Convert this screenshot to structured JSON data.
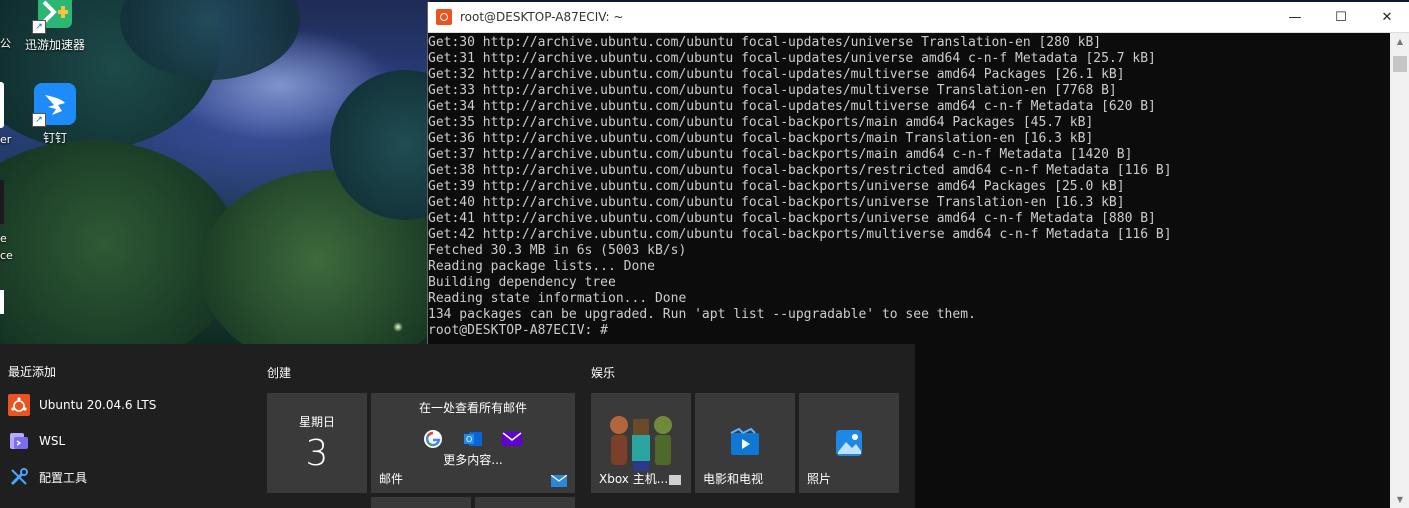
{
  "desktop": {
    "icons": [
      {
        "label": "迅游加速器",
        "icon": "xunyou-accelerator-icon"
      },
      {
        "label": "钉钉",
        "icon": "dingtalk-icon"
      }
    ],
    "edge_labels": [
      "公",
      "er",
      "e",
      "ce"
    ]
  },
  "terminal": {
    "title": "root@DESKTOP-A87ECIV: ~",
    "buttons": {
      "minimize": "—",
      "maximize": "☐",
      "close": "✕"
    },
    "lines": [
      "Get:30 http://archive.ubuntu.com/ubuntu focal-updates/universe Translation-en [280 kB]",
      "Get:31 http://archive.ubuntu.com/ubuntu focal-updates/universe amd64 c-n-f Metadata [25.7 kB]",
      "Get:32 http://archive.ubuntu.com/ubuntu focal-updates/multiverse amd64 Packages [26.1 kB]",
      "Get:33 http://archive.ubuntu.com/ubuntu focal-updates/multiverse Translation-en [7768 B]",
      "Get:34 http://archive.ubuntu.com/ubuntu focal-updates/multiverse amd64 c-n-f Metadata [620 B]",
      "Get:35 http://archive.ubuntu.com/ubuntu focal-backports/main amd64 Packages [45.7 kB]",
      "Get:36 http://archive.ubuntu.com/ubuntu focal-backports/main Translation-en [16.3 kB]",
      "Get:37 http://archive.ubuntu.com/ubuntu focal-backports/main amd64 c-n-f Metadata [1420 B]",
      "Get:38 http://archive.ubuntu.com/ubuntu focal-backports/restricted amd64 c-n-f Metadata [116 B]",
      "Get:39 http://archive.ubuntu.com/ubuntu focal-backports/universe amd64 Packages [25.0 kB]",
      "Get:40 http://archive.ubuntu.com/ubuntu focal-backports/universe Translation-en [16.3 kB]",
      "Get:41 http://archive.ubuntu.com/ubuntu focal-backports/universe amd64 c-n-f Metadata [880 B]",
      "Get:42 http://archive.ubuntu.com/ubuntu focal-backports/multiverse amd64 c-n-f Metadata [116 B]",
      "Fetched 30.3 MB in 6s (5003 kB/s)",
      "Reading package lists... Done",
      "Building dependency tree",
      "Reading state information... Done",
      "134 packages can be upgraded. Run 'apt list --upgradable' to see them.",
      "root@DESKTOP-A87ECIV: #"
    ]
  },
  "startmenu": {
    "recent_title": "最近添加",
    "recent_items": [
      {
        "label": "Ubuntu 20.04.6 LTS",
        "icon": "ubuntu-icon"
      },
      {
        "label": "WSL",
        "icon": "wsl-icon"
      },
      {
        "label": "配置工具",
        "icon": "tools-icon"
      }
    ],
    "create_title": "创建",
    "play_title": "娱乐",
    "calendar_tile": {
      "weekday": "星期日",
      "day": "3"
    },
    "mail_tile": {
      "header": "在一处查看所有邮件",
      "more": "更多内容...",
      "label": "邮件"
    },
    "xbox_tile": {
      "label": "Xbox 主机..."
    },
    "movies_tile": {
      "label": "电影和电视"
    },
    "photos_tile": {
      "label": "照片"
    }
  },
  "colors": {
    "terminal_bg": "#0c0c0c",
    "terminal_text": "#cccccc",
    "startmenu_bg": "#1f1f1f",
    "tile_bg": "#3a3a3a",
    "ubuntu_orange": "#e95420"
  }
}
